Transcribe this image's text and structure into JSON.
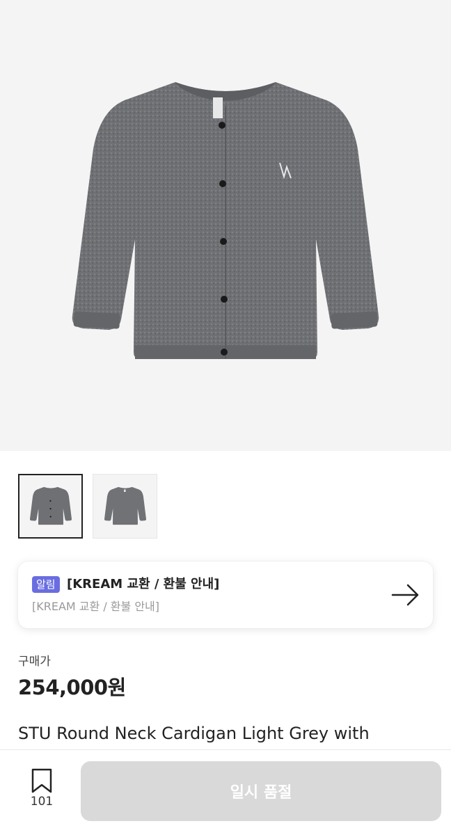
{
  "notice": {
    "badge": "알림",
    "title": "[KREAM 교환 / 환불 안내]",
    "subtitle": "[KREAM 교환 / 환불 안내]"
  },
  "price": {
    "label": "구매가",
    "value": "254,000원"
  },
  "product": {
    "title": "STU Round Neck Cardigan Light Grey with"
  },
  "bottom_bar": {
    "bookmark_count": "101",
    "cta_label": "일시 품절"
  },
  "thumbnails": [
    {
      "selected": true
    },
    {
      "selected": false
    }
  ],
  "colors": {
    "badge": "#6a6de0",
    "cta_disabled": "#d9d9d9",
    "hero_bg": "#f4f4f4"
  }
}
